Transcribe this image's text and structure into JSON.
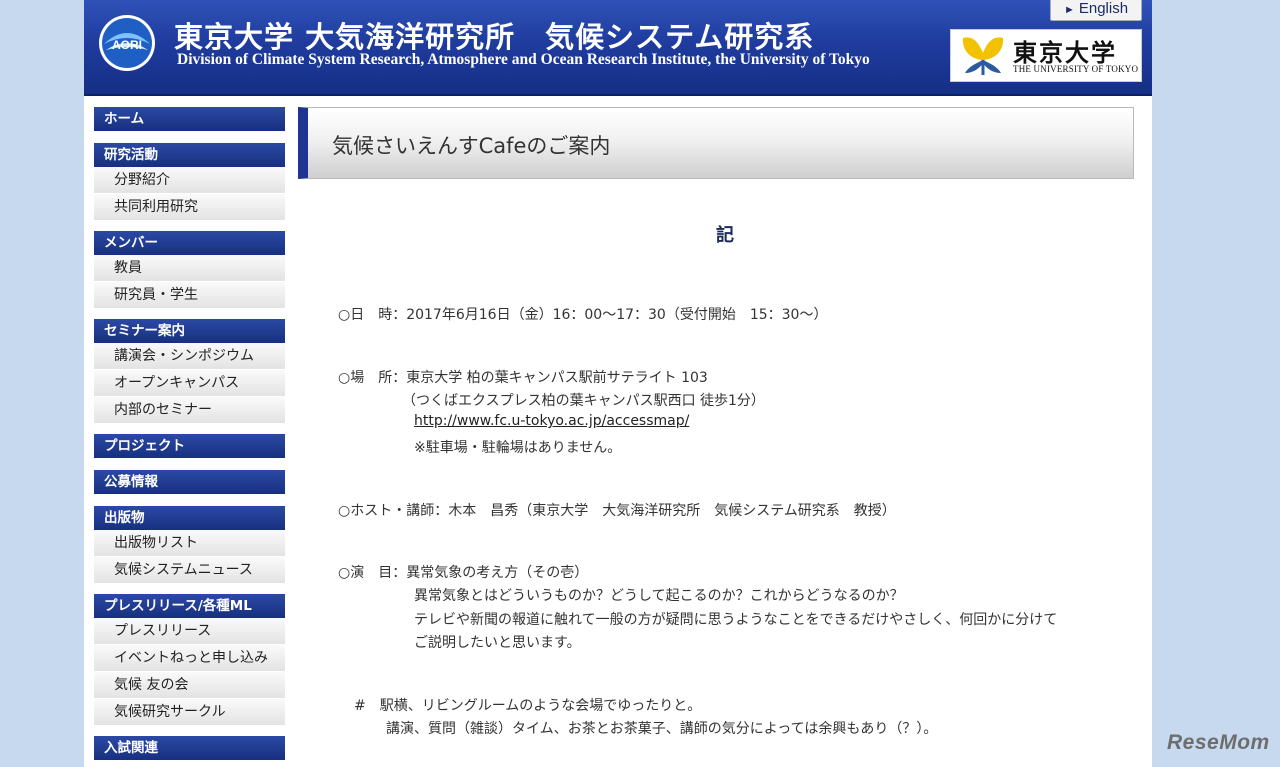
{
  "header": {
    "title": "東京大学 大気海洋研究所　気候システム研究系",
    "subtitle": "Division of Climate System Research, Atmosphere and Ocean Research Institute, the University of Tokyo",
    "logo_text": "AORI",
    "english_link": "English",
    "ut_logo_jp": "東京大学",
    "ut_logo_en": "THE UNIVERSITY OF TOKYO"
  },
  "sidebar": {
    "home": "ホーム",
    "research": {
      "label": "研究活動",
      "items": [
        "分野紹介",
        "共同利用研究"
      ]
    },
    "members": {
      "label": "メンバー",
      "items": [
        "教員",
        "研究員・学生"
      ]
    },
    "seminar": {
      "label": "セミナー案内",
      "items": [
        "講演会・シンポジウム",
        "オープンキャンパス",
        "内部のセミナー"
      ]
    },
    "project": "プロジェクト",
    "recruit": "公募情報",
    "publications": {
      "label": "出版物",
      "items": [
        "出版物リスト",
        "気候システムニュース"
      ]
    },
    "press": {
      "label": "プレスリリース/各種ML",
      "items": [
        "プレスリリース",
        "イベントねっと申し込み",
        "気候 友の会",
        "気候研究サークル"
      ]
    },
    "admission": "入試関連"
  },
  "main": {
    "page_title": "気候さいえんすCafeのご案内",
    "heading": "記",
    "date_line": "○日　時：2017年6月16日（金）16：00～17：30（受付開始　15：30～）",
    "place_line": "○場　所：東京大学 柏の葉キャンパス駅前サテライト 103",
    "place_access": "（つくばエクスプレス柏の葉キャンパス駅西口 徒歩1分）",
    "place_url": "http://www.fc.u-tokyo.ac.jp/accessmap/",
    "place_note": "※駐車場・駐輪場はありません。",
    "host_line": "○ホスト・講師：木本　昌秀（東京大学　大気海洋研究所　気候システム研究系　教授）",
    "topic_line": "○演　目：異常気象の考え方（その壱）",
    "topic_desc1": "異常気象とはどういうものか？どうして起こるのか？これからどうなるのか？",
    "topic_desc2": "テレビや新聞の報道に触れて一般の方が疑問に思うようなことをできるだけやさしく、何回かに分けて",
    "topic_desc3": "ご説明したいと思います。",
    "note_line1": "#　駅横、リビングルームのような会場でゆったりと。",
    "note_line2": "講演、質問（雑談）タイム、お茶とお茶菓子、講師の気分によっては余興もあり（？）。"
  },
  "watermark": "ReseMom"
}
